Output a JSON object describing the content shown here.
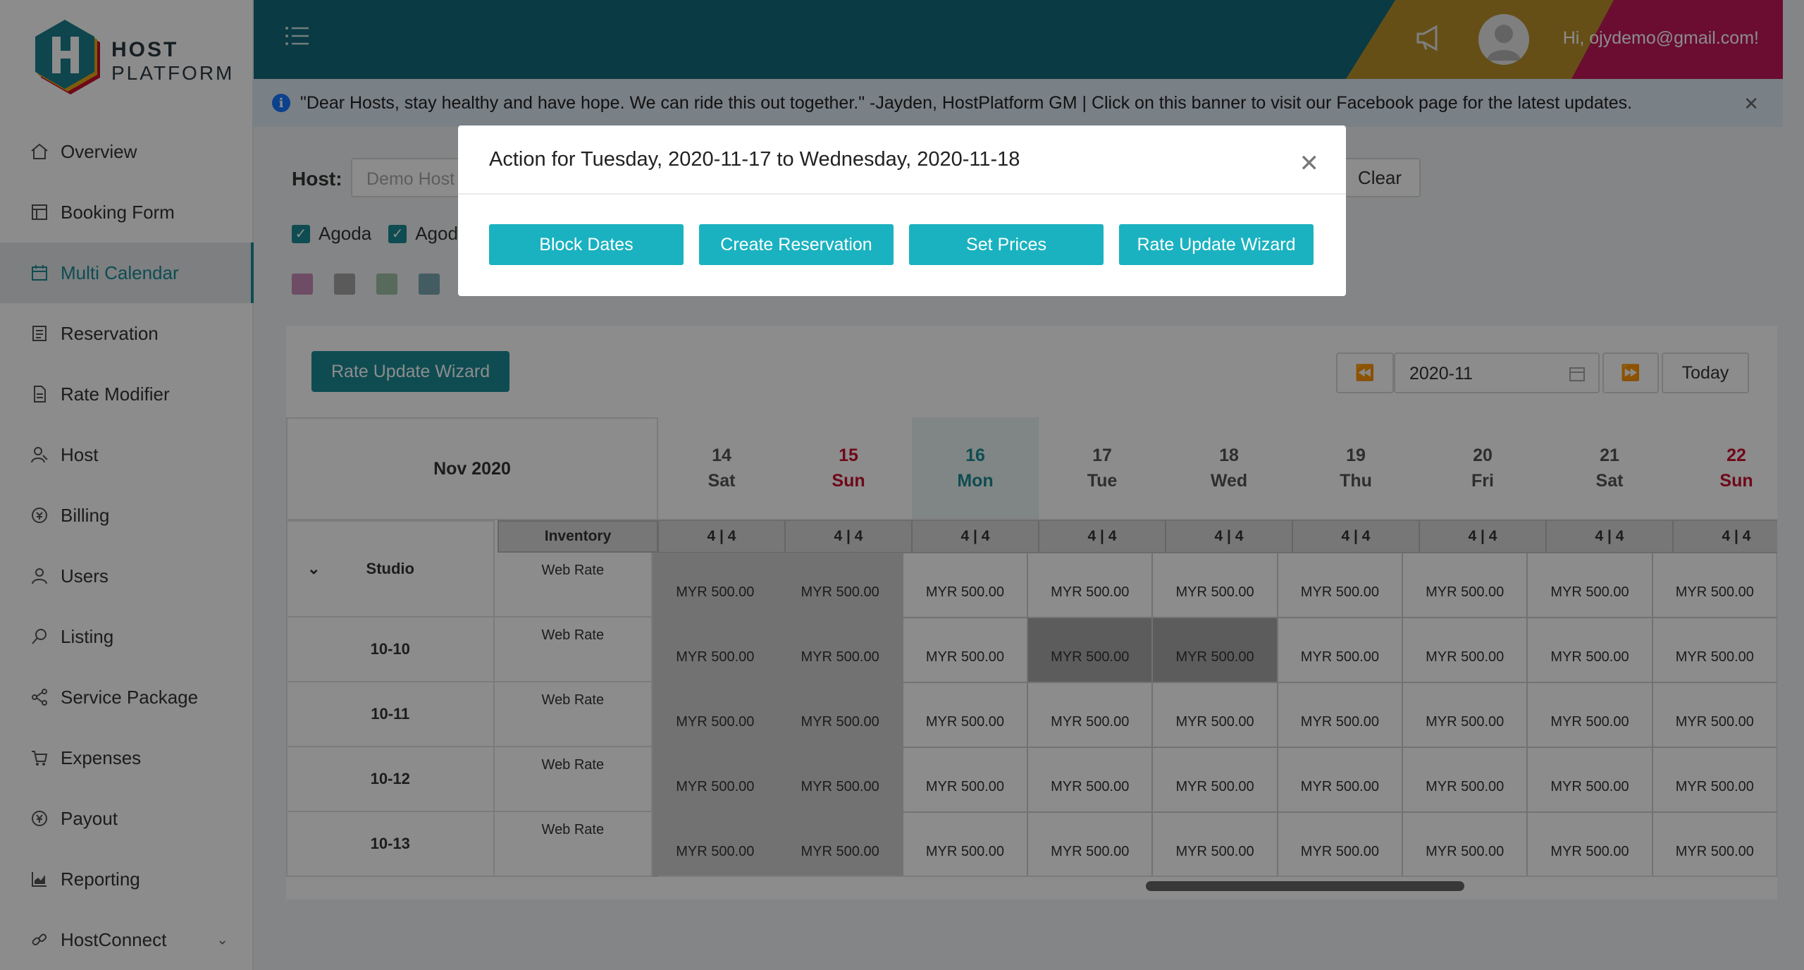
{
  "brand": {
    "line1": "HOST",
    "line2": "PLATFORM"
  },
  "sidebar": {
    "items": [
      {
        "label": "Overview",
        "icon": "home-icon"
      },
      {
        "label": "Booking Form",
        "icon": "form-icon"
      },
      {
        "label": "Multi Calendar",
        "icon": "calendar-icon",
        "active": true
      },
      {
        "label": "Reservation",
        "icon": "list-icon"
      },
      {
        "label": "Rate Modifier",
        "icon": "document-icon"
      },
      {
        "label": "Host",
        "icon": "host-icon"
      },
      {
        "label": "Billing",
        "icon": "billing-icon"
      },
      {
        "label": "Users",
        "icon": "user-icon"
      },
      {
        "label": "Listing",
        "icon": "search-icon"
      },
      {
        "label": "Service Package",
        "icon": "share-icon"
      },
      {
        "label": "Expenses",
        "icon": "cart-icon"
      },
      {
        "label": "Payout",
        "icon": "money-icon"
      },
      {
        "label": "Reporting",
        "icon": "chart-icon"
      },
      {
        "label": "HostConnect",
        "icon": "link-icon"
      }
    ]
  },
  "header": {
    "user_greeting": "Hi, ojydemo@gmail.com!"
  },
  "banner": {
    "text": "\"Dear Hosts, stay healthy and have hope. We can ride this out together.\" -Jayden, HostPlatform GM | Click on this banner to visit our Facebook page for the latest updates."
  },
  "filters": {
    "host_label": "Host:",
    "host_placeholder": "Demo Host",
    "clear_label": "Clear",
    "channels": [
      "Agoda",
      "Agoda"
    ],
    "swatch_colors": [
      "#c98ab8",
      "#a4a4a4",
      "#9fc2a6",
      "#7aa8b2"
    ]
  },
  "calendar": {
    "rate_wizard_label": "Rate Update Wizard",
    "month_value": "2020-11",
    "today_label": "Today",
    "month_title": "Nov 2020",
    "inventory_label": "Inventory",
    "days": [
      {
        "num": "14",
        "dow": "Sat",
        "type": "normal"
      },
      {
        "num": "15",
        "dow": "Sun",
        "type": "sun"
      },
      {
        "num": "16",
        "dow": "Mon",
        "type": "today"
      },
      {
        "num": "17",
        "dow": "Tue",
        "type": "normal"
      },
      {
        "num": "18",
        "dow": "Wed",
        "type": "normal"
      },
      {
        "num": "19",
        "dow": "Thu",
        "type": "normal"
      },
      {
        "num": "20",
        "dow": "Fri",
        "type": "normal"
      },
      {
        "num": "21",
        "dow": "Sat",
        "type": "normal"
      },
      {
        "num": "22",
        "dow": "Sun",
        "type": "sun"
      }
    ],
    "inventory": [
      "4 | 4",
      "4 | 4",
      "4 | 4",
      "4 | 4",
      "4 | 4",
      "4 | 4",
      "4 | 4",
      "4 | 4",
      "4 | 4"
    ],
    "rows": [
      {
        "room": "Studio",
        "rate": "Web Rate",
        "expandable": true,
        "prices": [
          "MYR 500.00",
          "MYR 500.00",
          "MYR 500.00",
          "MYR 500.00",
          "MYR 500.00",
          "MYR 500.00",
          "MYR 500.00",
          "MYR 500.00",
          "MYR 500.00"
        ],
        "shade": [
          1,
          1,
          0,
          0,
          0,
          0,
          0,
          0,
          0
        ]
      },
      {
        "room": "10-10",
        "rate": "Web Rate",
        "expandable": false,
        "prices": [
          "MYR 500.00",
          "MYR 500.00",
          "MYR 500.00",
          "MYR 500.00",
          "MYR 500.00",
          "MYR 500.00",
          "MYR 500.00",
          "MYR 500.00",
          "MYR 500.00"
        ],
        "shade": [
          1,
          1,
          0,
          2,
          2,
          0,
          0,
          0,
          0
        ]
      },
      {
        "room": "10-11",
        "rate": "Web Rate",
        "expandable": false,
        "prices": [
          "MYR 500.00",
          "MYR 500.00",
          "MYR 500.00",
          "MYR 500.00",
          "MYR 500.00",
          "MYR 500.00",
          "MYR 500.00",
          "MYR 500.00",
          "MYR 500.00"
        ],
        "shade": [
          1,
          1,
          0,
          0,
          0,
          0,
          0,
          0,
          0
        ]
      },
      {
        "room": "10-12",
        "rate": "Web Rate",
        "expandable": false,
        "prices": [
          "MYR 500.00",
          "MYR 500.00",
          "MYR 500.00",
          "MYR 500.00",
          "MYR 500.00",
          "MYR 500.00",
          "MYR 500.00",
          "MYR 500.00",
          "MYR 500.00"
        ],
        "shade": [
          1,
          1,
          0,
          0,
          0,
          0,
          0,
          0,
          0
        ]
      },
      {
        "room": "10-13",
        "rate": "Web Rate",
        "expandable": false,
        "prices": [
          "MYR 500.00",
          "MYR 500.00",
          "MYR 500.00",
          "MYR 500.00",
          "MYR 500.00",
          "MYR 500.00",
          "MYR 500.00",
          "MYR 500.00",
          "MYR 500.00"
        ],
        "shade": [
          1,
          1,
          0,
          0,
          0,
          0,
          0,
          0,
          0
        ]
      }
    ]
  },
  "modal": {
    "title": "Action for Tuesday, 2020-11-17 to Wednesday, 2020-11-18",
    "buttons": [
      "Block Dates",
      "Create Reservation",
      "Set Prices",
      "Rate Update Wizard"
    ]
  },
  "colors": {
    "accent": "#1a8a96",
    "header": "#136b7a",
    "modal_button": "#1ab2c0",
    "sunday": "#c8102e"
  }
}
